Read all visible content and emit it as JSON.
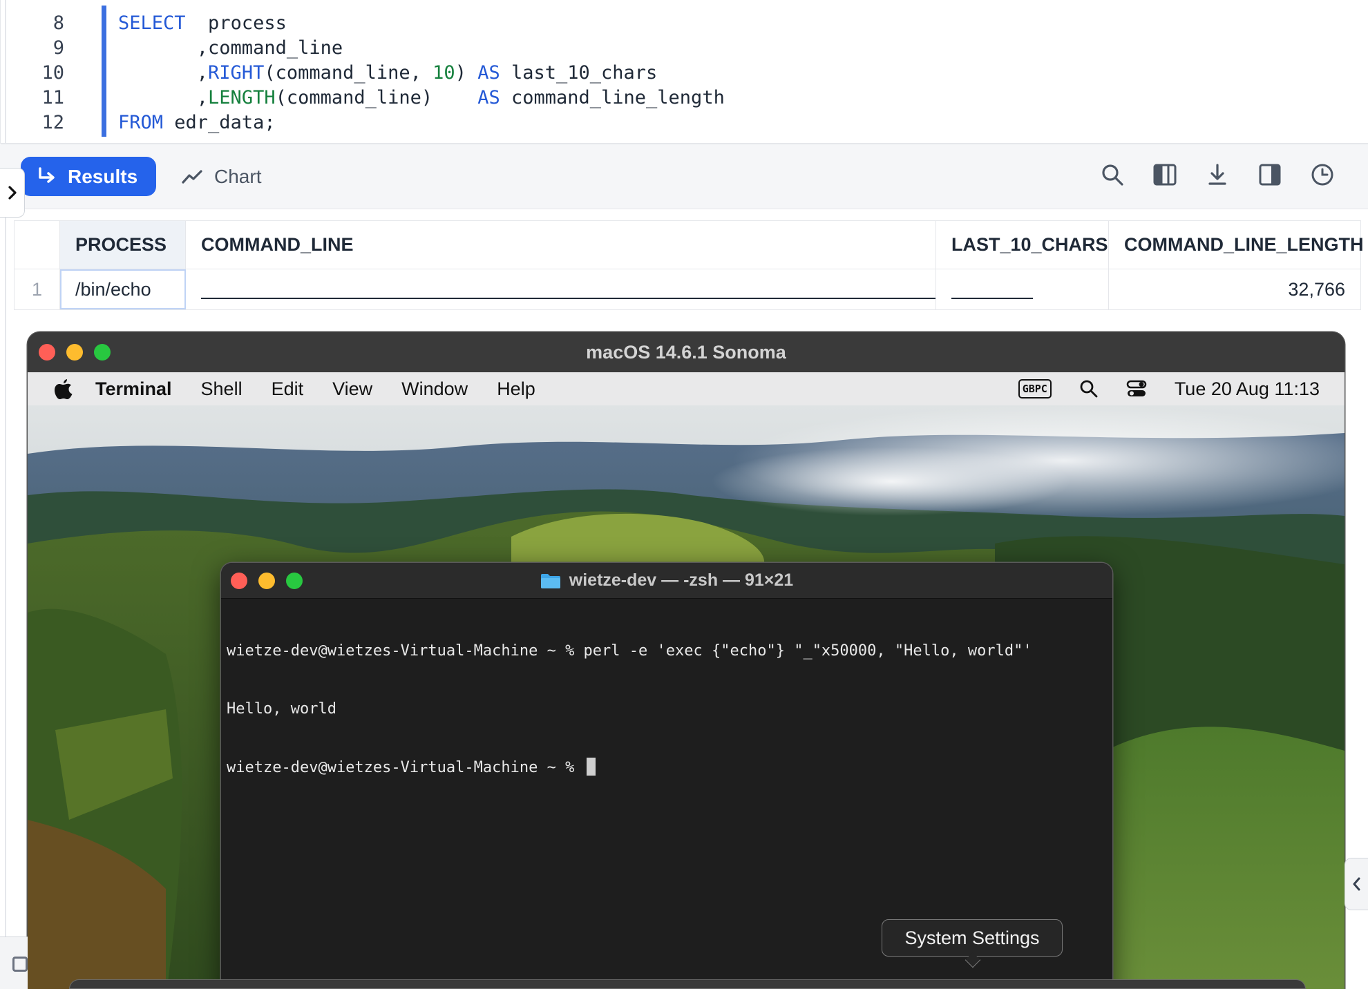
{
  "editor": {
    "lines": [
      {
        "num": "8",
        "parts": [
          {
            "t": "SELECT",
            "c": "kw"
          },
          {
            "t": "  process",
            "c": ""
          }
        ]
      },
      {
        "num": "9",
        "parts": [
          {
            "t": "       ,command_line",
            "c": ""
          }
        ]
      },
      {
        "num": "10",
        "parts": [
          {
            "t": "       ,",
            "c": ""
          },
          {
            "t": "RIGHT",
            "c": "fn"
          },
          {
            "t": "(command_line, ",
            "c": ""
          },
          {
            "t": "10",
            "c": "num"
          },
          {
            "t": ") ",
            "c": ""
          },
          {
            "t": "AS",
            "c": "kw"
          },
          {
            "t": " last_10_chars",
            "c": ""
          }
        ]
      },
      {
        "num": "11",
        "parts": [
          {
            "t": "       ,",
            "c": ""
          },
          {
            "t": "LENGTH",
            "c": "num"
          },
          {
            "t": "(command_line)    ",
            "c": ""
          },
          {
            "t": "AS",
            "c": "kw"
          },
          {
            "t": " command_line_length",
            "c": ""
          }
        ]
      },
      {
        "num": "12",
        "parts": [
          {
            "t": "FROM",
            "c": "kw"
          },
          {
            "t": " edr_data;",
            "c": ""
          }
        ]
      }
    ]
  },
  "toolbar": {
    "results_label": "Results",
    "chart_label": "Chart",
    "icons": [
      "search-icon",
      "columns-icon",
      "download-icon",
      "split-view-icon",
      "history-icon"
    ]
  },
  "table": {
    "headers": {
      "process": "PROCESS",
      "command_line": "COMMAND_LINE",
      "last_10_chars": "LAST_10_CHARS",
      "command_line_length": "COMMAND_LINE_LENGTH"
    },
    "rows": [
      {
        "row_number": "1",
        "process": "/bin/echo",
        "command_line_length": "32,766"
      }
    ]
  },
  "vm": {
    "window_title": "macOS 14.6.1 Sonoma",
    "menubar": {
      "app_name": "Terminal",
      "menus": [
        "Shell",
        "Edit",
        "View",
        "Window",
        "Help"
      ],
      "input_source": "GBPC",
      "datetime": "Tue 20 Aug  11:13"
    }
  },
  "terminal": {
    "title": "wietze-dev — -zsh — 91×21",
    "lines": [
      "wietze-dev@wietzes-Virtual-Machine ~ % perl -e 'exec {\"echo\"} \"_\"x50000, \"Hello, world\"'",
      "Hello, world",
      "wietze-dev@wietzes-Virtual-Machine ~ % "
    ]
  },
  "tooltip": {
    "label": "System Settings"
  },
  "colors": {
    "accent": "#2563eb",
    "keyword": "#2459d6",
    "number": "#15803d",
    "close": "#ff5f57",
    "minimize": "#febc2e",
    "zoom": "#28c840"
  }
}
